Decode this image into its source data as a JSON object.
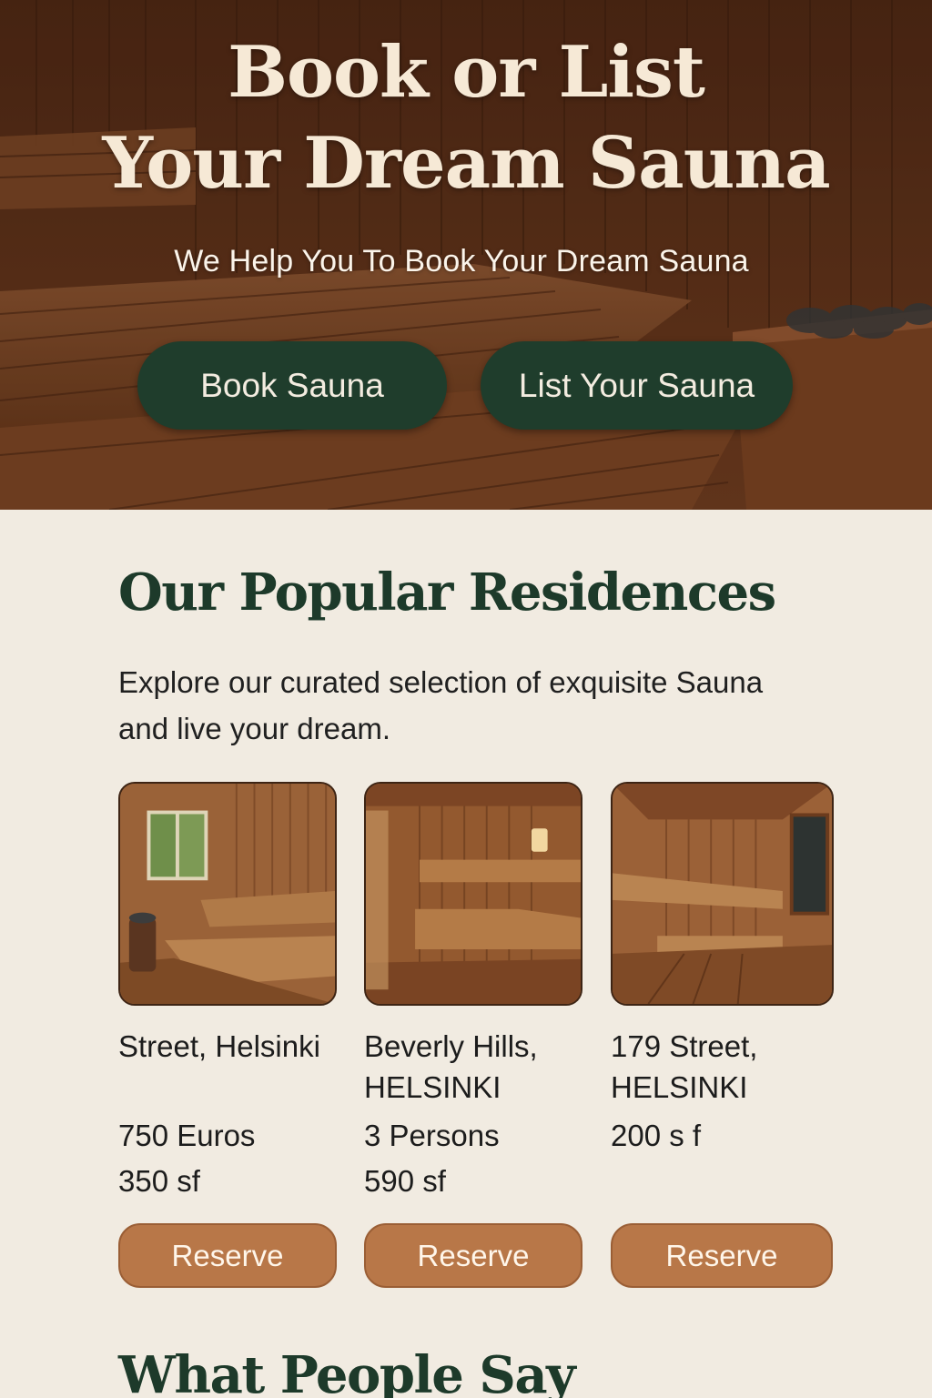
{
  "hero": {
    "title_line1": "Book or List",
    "title_line2": "Your Dream Sauna",
    "subtitle": "We Help You To Book Your Dream Sauna",
    "book_button": "Book Sauna",
    "list_button": "List Your Sauna",
    "button_color": "#1f3d2c"
  },
  "residences": {
    "title": "Our Popular Residences",
    "description": "Explore our curated selection of exquisite Sauna and live your dream.",
    "cards": [
      {
        "address": "Street, Helsinki",
        "line2": "750 Euros",
        "line3": "350 sf",
        "button": "Reserve"
      },
      {
        "address": "Beverly Hills, HELSINKI",
        "line2": "3 Persons",
        "line3": "590 sf",
        "button": "Reserve"
      },
      {
        "address": "179 Street, HELSINKI",
        "line2": "200 s f",
        "line3": "",
        "button": "Reserve"
      }
    ],
    "button_color": "#b87748"
  },
  "testimonials": {
    "title": "What People Say"
  }
}
